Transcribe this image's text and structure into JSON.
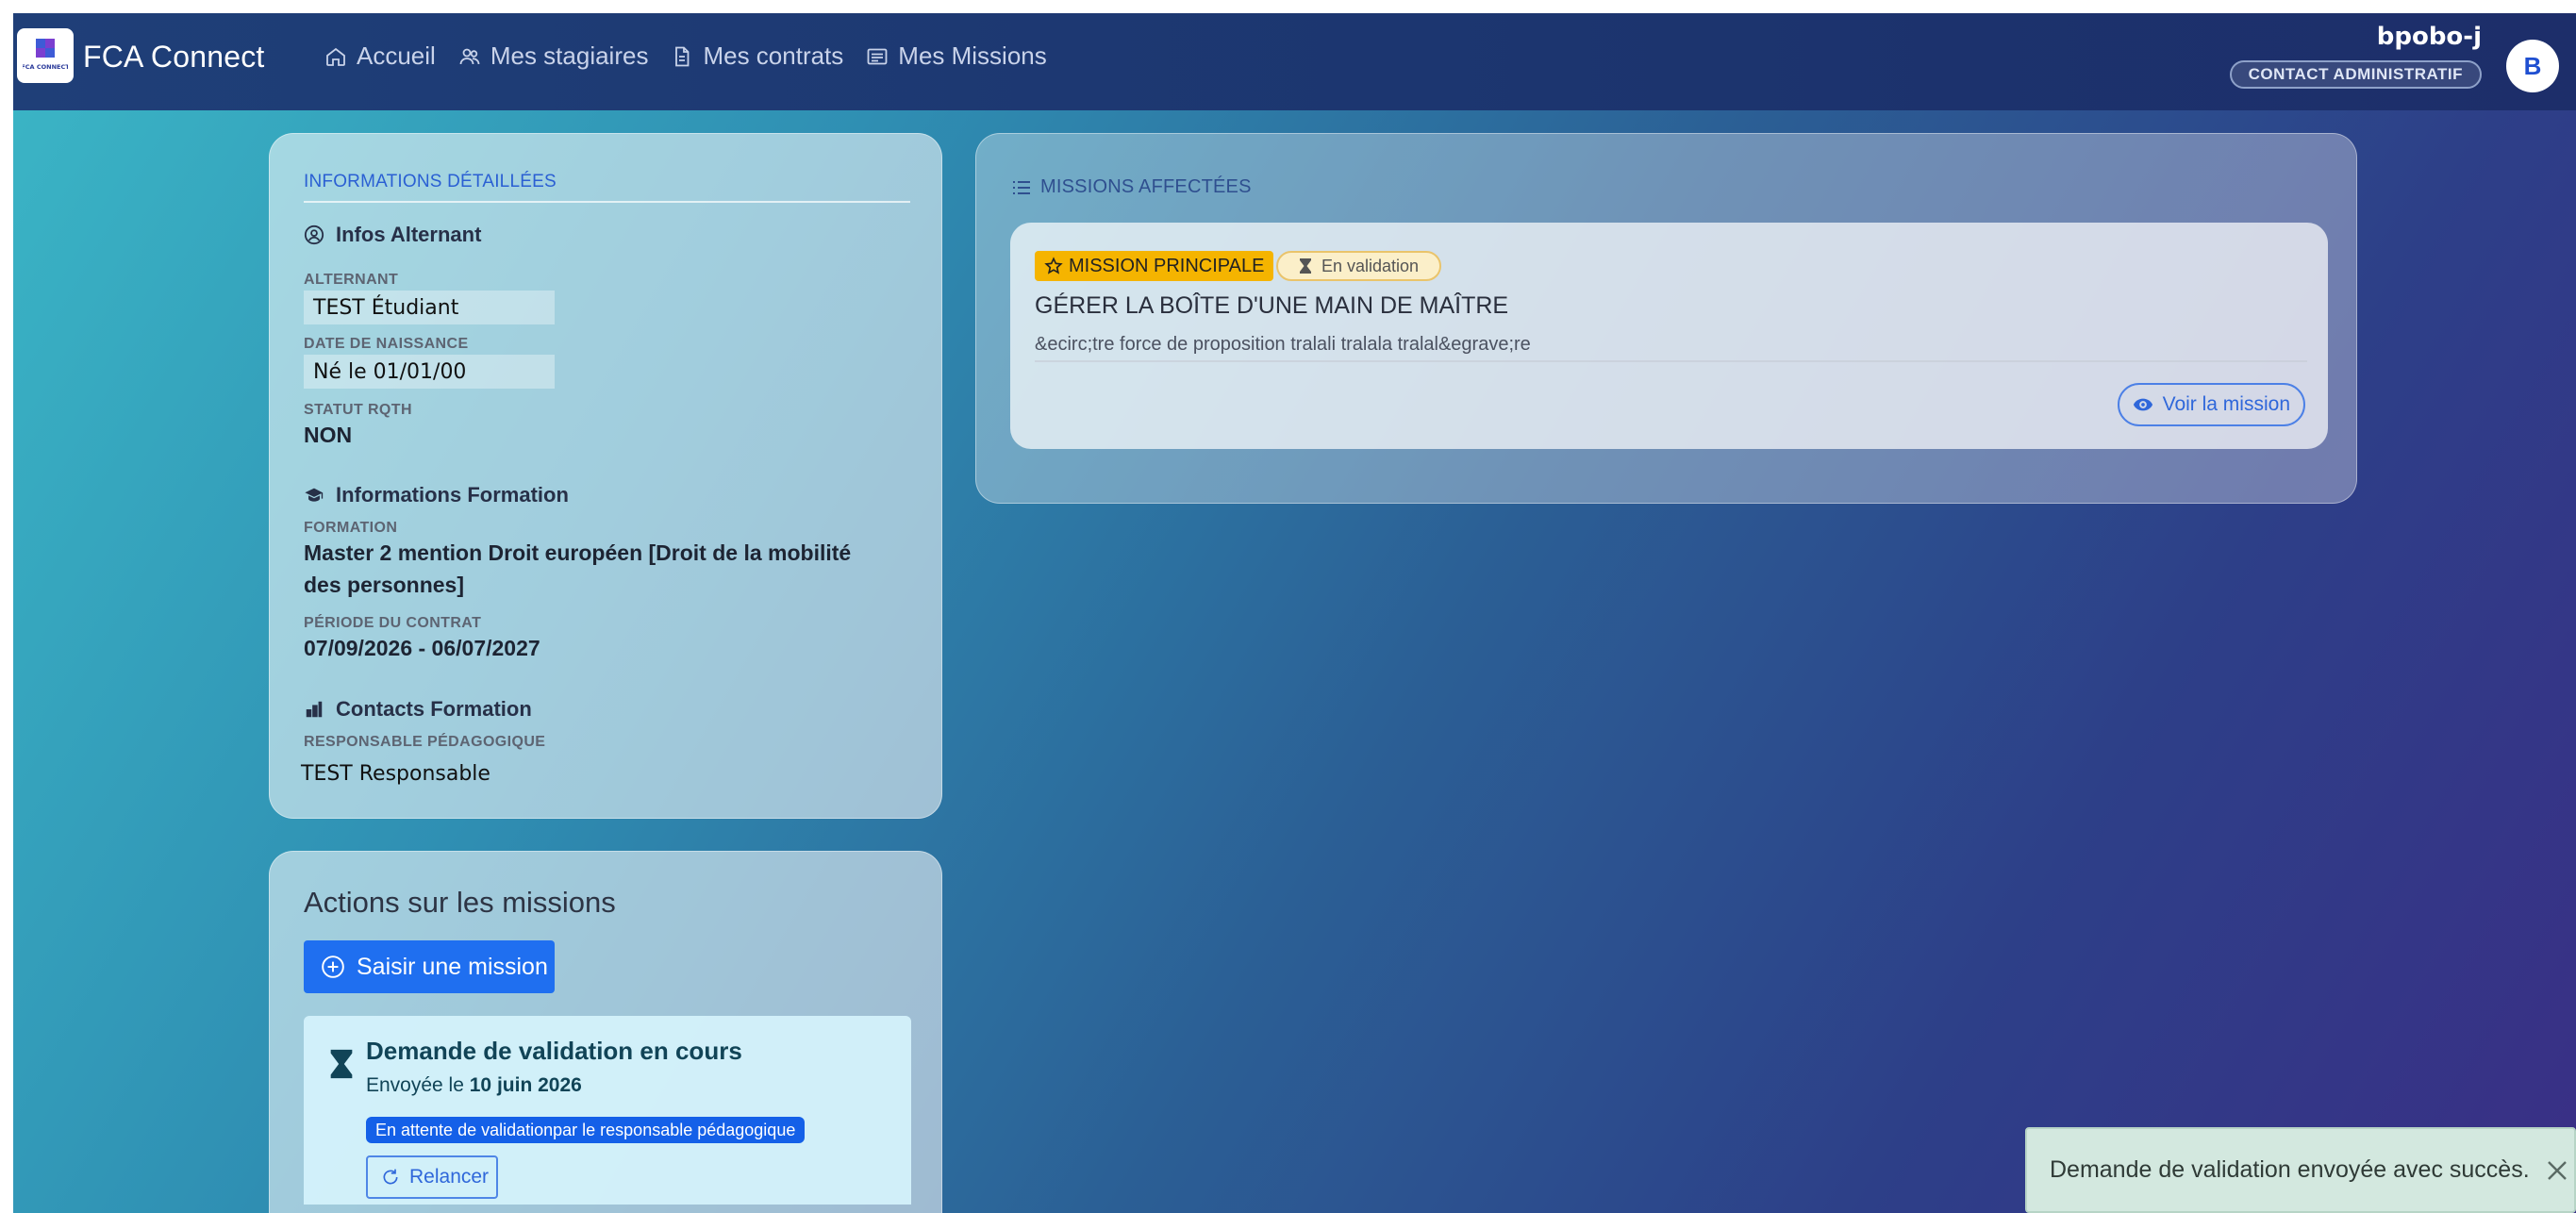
{
  "app": {
    "name": "FCA Connect",
    "logo_text": "FCA CONNECT"
  },
  "nav": {
    "items": [
      {
        "label": "Accueil",
        "icon": "home-icon"
      },
      {
        "label": "Mes stagiaires",
        "icon": "users-icon"
      },
      {
        "label": "Mes contrats",
        "icon": "document-icon"
      },
      {
        "label": "Mes Missions",
        "icon": "id-card-icon"
      }
    ]
  },
  "user": {
    "username": "bpobo-j",
    "role": "CONTACT ADMINISTRATIF",
    "avatar_initial": "B"
  },
  "details": {
    "section_title": "INFORMATIONS DÉTAILLÉES",
    "alternant": {
      "heading": "Infos Alternant",
      "name_label": "ALTERNANT",
      "name_value": "TEST Étudiant",
      "birth_label": "DATE DE NAISSANCE",
      "birth_value": "Né le 01/01/00",
      "rqth_label": "STATUT RQTH",
      "rqth_value": "NON"
    },
    "formation": {
      "heading": "Informations Formation",
      "formation_label": "FORMATION",
      "formation_value": "Master 2 mention Droit européen [Droit de la mobilité des personnes]",
      "period_label": "PÉRIODE DU CONTRAT",
      "period_value": "07/09/2026 - 06/07/2027"
    },
    "contacts": {
      "heading": "Contacts Formation",
      "resp_label": "RESPONSABLE PÉDAGOGIQUE",
      "resp_value": "TEST Responsable"
    }
  },
  "missions": {
    "section_title": "MISSIONS AFFECTÉES",
    "items": [
      {
        "badge_principal": "MISSION PRINCIPALE",
        "badge_status": "En validation",
        "title": "GÉRER LA BOÎTE D'UNE MAIN DE MAÎTRE",
        "description": "&ecirc;tre force de proposition tralali tralala tralal&egrave;re",
        "view_button": "Voir la mission"
      }
    ]
  },
  "actions": {
    "title": "Actions sur les missions",
    "add_button": "Saisir une mission",
    "validation": {
      "title": "Demande de validation en cours",
      "sent_prefix": "Envoyée le ",
      "sent_date": "10 juin 2026",
      "status_pill": "En attente de validationpar le responsable pédagogique",
      "relaunch_button": "Relancer"
    }
  },
  "toast": {
    "message": "Demande de validation envoyée avec succès."
  },
  "colors": {
    "primary": "#1f6ff0",
    "navbar": "#1c356f",
    "badge_principal": "#f5b400",
    "toast_bg": "#d3e8df"
  }
}
